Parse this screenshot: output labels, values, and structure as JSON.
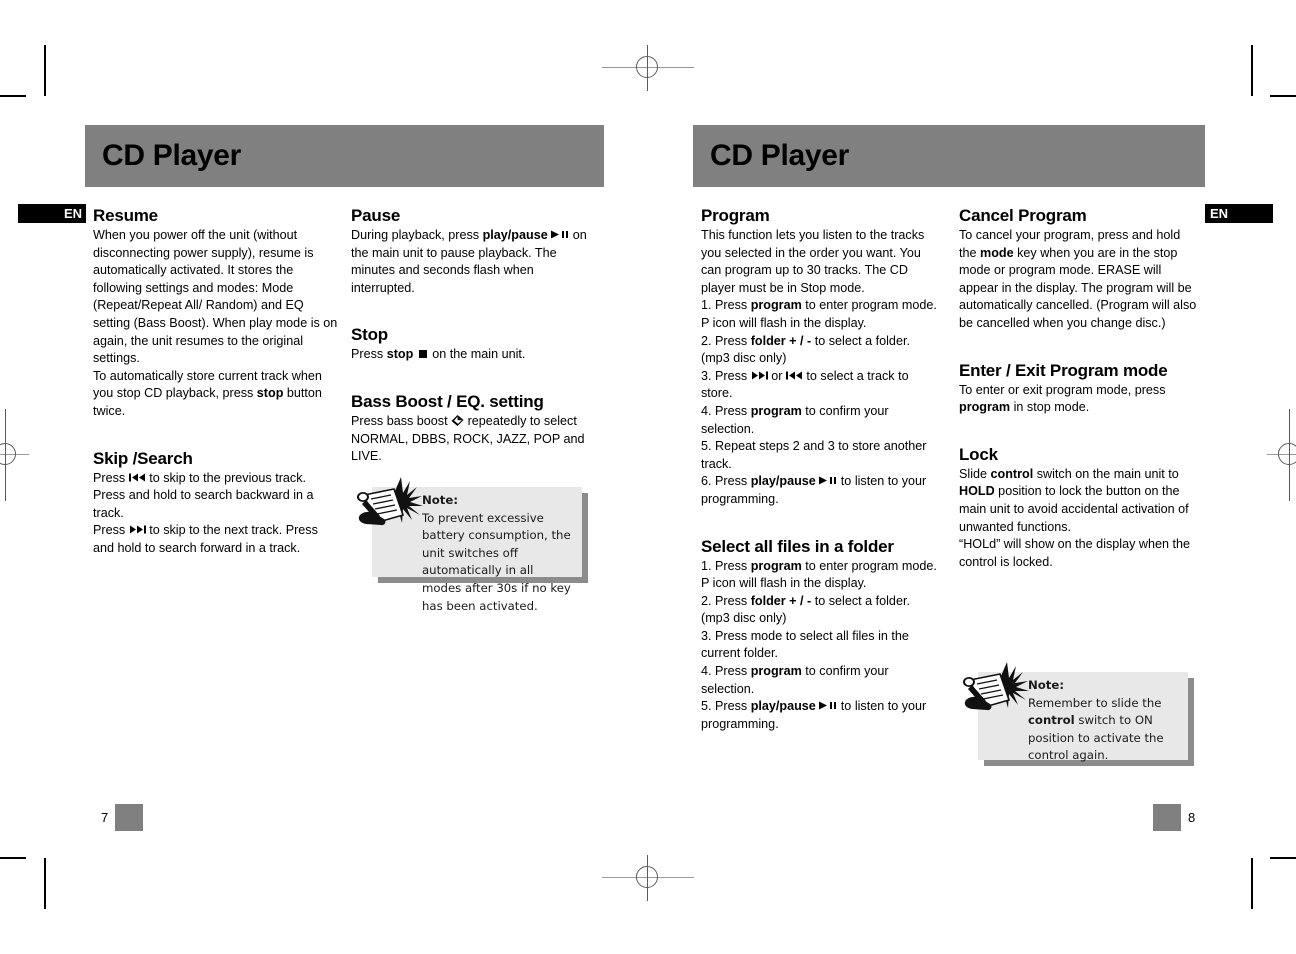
{
  "document": {
    "language_tab": "EN",
    "header_color": "#808080",
    "note_panel_color": "#e8e8e8",
    "note_shadow_color": "#8c8c8c"
  },
  "left_page": {
    "header_title": "CD Player",
    "page_number": "7",
    "column_one": {
      "resume": {
        "heading": "Resume",
        "paragraph1": "When you power off the unit (without disconnecting power supply), resume is automatically activated. It stores the following settings and modes: Mode (Repeat/Repeat All/ Random) and EQ setting (Bass Boost).  When play mode is on again, the unit resumes to the original settings.",
        "paragraph2_a": "To automatically store current track when you stop CD playback, press ",
        "paragraph2_bold": "stop",
        "paragraph2_b": " button twice."
      },
      "skip_search": {
        "heading": "Skip /Search",
        "line1_a": "Press",
        "line1_b": "to skip to the previous track. Press and hold to search backward in a track.",
        "line2_a": "Press",
        "line2_b": "to skip to the next track. Press and hold to search forward in a track."
      }
    },
    "column_two": {
      "pause": {
        "heading": "Pause",
        "text_a": "During playback, press ",
        "text_bold": "play/pause",
        "text_b": " on the main unit to pause playback. The minutes and seconds flash when interrupted."
      },
      "stop": {
        "heading": "Stop",
        "text_a": "Press ",
        "text_bold": "stop",
        "text_b": " on the main unit."
      },
      "bass_boost": {
        "heading": "Bass Boost / EQ. setting",
        "text_a": "Press bass boost ",
        "text_b": " repeatedly to select NORMAL, DBBS, ROCK, JAZZ, POP and LIVE."
      },
      "note": {
        "label": "Note:",
        "text": "To prevent excessive battery consumption, the unit switches off automatically in all modes after 30s if no key has been activated."
      }
    }
  },
  "right_page": {
    "header_title": "CD Player",
    "page_number": "8",
    "column_one": {
      "program": {
        "heading": "Program",
        "intro": "This function lets you listen to the tracks you selected in the order you want. You can program up to 30 tracks. The CD player must be in Stop mode.",
        "step1_a": "1. Press ",
        "step1_bold": "program",
        "step1_b": " to enter program mode. P icon will flash in the display.",
        "step2_a": "2.  Press ",
        "step2_bold": "folder + / -",
        "step2_b": " to select a folder. (mp3 disc only)",
        "step3_a": "3.  Press ",
        "step3_mid": " or ",
        "step3_b": " to select a track to store.",
        "step4_a": "4. Press ",
        "step4_bold": "program",
        "step4_b": " to confirm your selection.",
        "step5": "5. Repeat steps 2 and 3  to store another track.",
        "step6_a": "6. Press ",
        "step6_bold": "play/pause",
        "step6_b": " to listen to your programming."
      },
      "select_all": {
        "heading": "Select all files in a folder",
        "step1_a": "1. Press ",
        "step1_bold": "program",
        "step1_b": " to enter program mode. P icon will flash in the display.",
        "step2_a": "2.  Press ",
        "step2_bold": "folder + / -",
        "step2_b": " to select a folder. (mp3 disc only)",
        "step3": "3. Press mode to select all files in the current folder.",
        "step4_a": "4. Press ",
        "step4_bold": "program",
        "step4_b": " to confirm your selection.",
        "step5_a": "5. Press ",
        "step5_bold": "play/pause",
        "step5_b": " to listen to your programming."
      }
    },
    "column_two": {
      "cancel_program": {
        "heading": "Cancel Program",
        "text_a": "To cancel your program, press and hold the ",
        "text_bold": "mode",
        "text_b": " key when you are in the stop mode or program mode.  ERASE will appear in the display. The program will be automatically cancelled. (Program will also be cancelled when you change disc.)"
      },
      "enter_exit": {
        "heading": "Enter / Exit Program mode",
        "text_a": "To enter or exit program mode, press ",
        "text_bold": "program",
        "text_b": " in stop mode."
      },
      "lock": {
        "heading": "Lock",
        "text_a": "Slide ",
        "text_bold1": "control",
        "text_b": " switch on the main unit to ",
        "text_bold2": "HOLD",
        "text_c": " position to lock the button on the main unit to avoid accidental activation of unwanted functions.",
        "text_d": "“HOLd” will show on the display when the control is locked."
      },
      "note": {
        "label": "Note:",
        "text_a": "Remember to slide the ",
        "text_bold": "control",
        "text_b": " switch to ON  position to activate the control again."
      }
    }
  }
}
